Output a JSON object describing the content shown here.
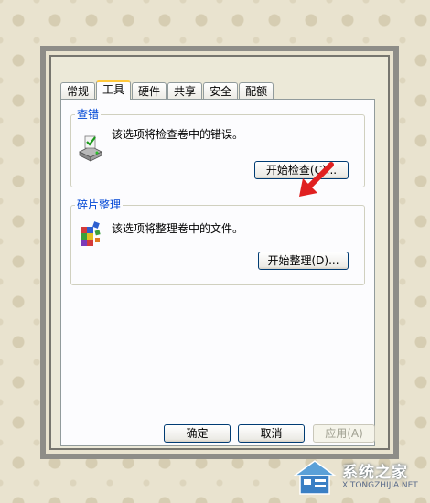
{
  "tabs": [
    {
      "label": "常规"
    },
    {
      "label": "工具"
    },
    {
      "label": "硬件"
    },
    {
      "label": "共享"
    },
    {
      "label": "安全"
    },
    {
      "label": "配额"
    }
  ],
  "active_tab": "工具",
  "error_check": {
    "title": "查错",
    "description": "该选项将检查卷中的错误。",
    "button_label": "开始检查(C)..."
  },
  "defrag": {
    "title": "碎片整理",
    "description": "该选项将整理卷中的文件。",
    "button_label": "开始整理(D)..."
  },
  "footer": {
    "ok_label": "确定",
    "cancel_label": "取消",
    "apply_label": "应用(A)"
  },
  "watermark": {
    "text": "系统之家",
    "url": "XITONGZHIJIA.NET"
  },
  "colors": {
    "accent_arrow": "#e02020",
    "group_title": "#0046d5",
    "active_tab_highlight": "#ffc83c"
  }
}
